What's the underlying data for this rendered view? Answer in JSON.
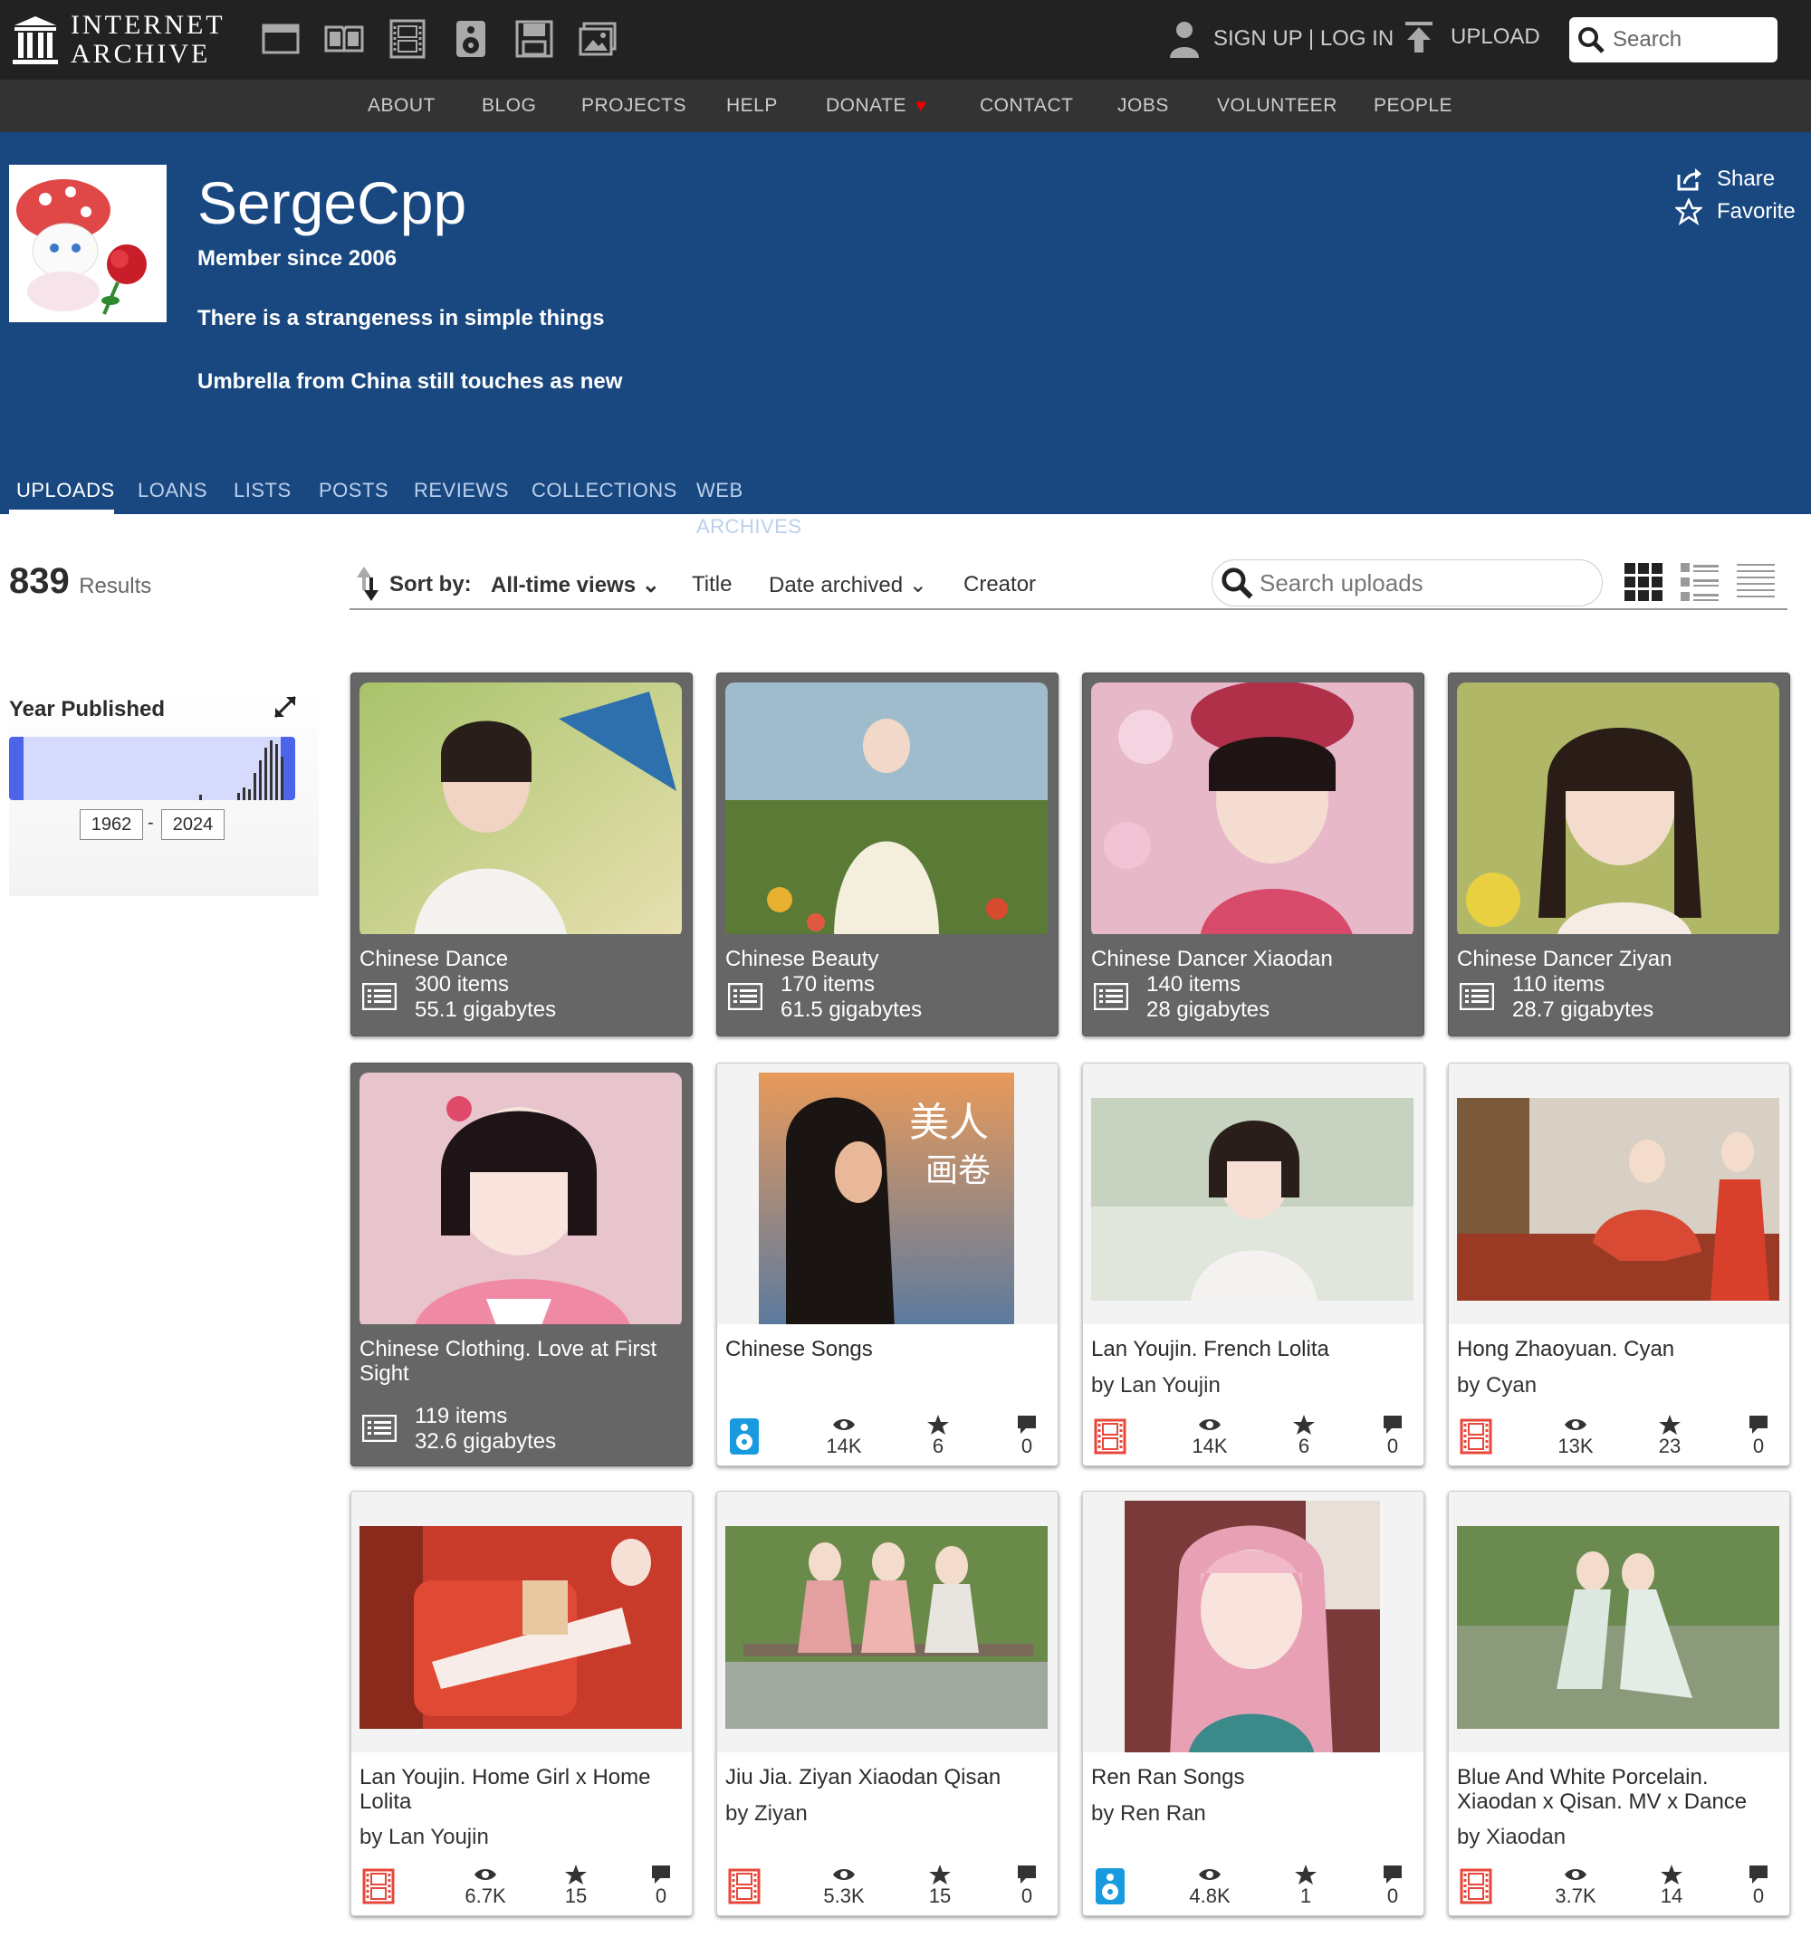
{
  "header": {
    "logo_line1": "INTERNET",
    "logo_line2": "ARCHIVE",
    "auth_label": "SIGN UP | LOG IN",
    "upload_label": "UPLOAD",
    "search_placeholder": "Search",
    "media_icons": [
      "web-icon",
      "texts-icon",
      "video-icon",
      "audio-icon",
      "software-icon",
      "images-icon"
    ]
  },
  "nav": {
    "about": "ABOUT",
    "blog": "BLOG",
    "projects": "PROJECTS",
    "help": "HELP",
    "donate": "DONATE",
    "contact": "CONTACT",
    "jobs": "JOBS",
    "volunteer": "VOLUNTEER",
    "people": "PEOPLE"
  },
  "profile": {
    "name": "SergeCpp",
    "member_since": "Member since 2006",
    "bio_line1": "There is a strangeness in simple things",
    "bio_line2": "Umbrella from China still touches as new",
    "share": "Share",
    "favorite": "Favorite"
  },
  "tabs": {
    "uploads": "UPLOADS",
    "loans": "LOANS",
    "lists": "LISTS",
    "posts": "POSTS",
    "reviews": "REVIEWS",
    "collections": "COLLECTIONS",
    "web_archives": "WEB ARCHIVES"
  },
  "results": {
    "count": "839",
    "label": "Results"
  },
  "facet": {
    "title": "Year Published",
    "from": "1962",
    "to": "2024"
  },
  "sort": {
    "label": "Sort by:",
    "views": "All-time views",
    "title": "Title",
    "date": "Date archived",
    "creator": "Creator",
    "search_placeholder": "Search uploads"
  },
  "colors": {
    "header_bg": "#222222",
    "nav_bg": "#333333",
    "profile_bg": "#194880",
    "accent": "#4b64ea"
  },
  "tiles": [
    {
      "title": "Chinese Dance",
      "items": "300 items",
      "size": "55.1 gigabytes"
    },
    {
      "title": "Chinese Beauty",
      "items": "170 items",
      "size": "61.5 gigabytes"
    },
    {
      "title": "Chinese Dancer Xiaodan",
      "items": "140 items",
      "size": "28 gigabytes"
    },
    {
      "title": "Chinese Dancer Ziyan",
      "items": "110 items",
      "size": "28.7 gigabytes"
    },
    {
      "title": "Chinese Clothing. Love at First Sight",
      "items": "119 items",
      "size": "32.6 gigabytes"
    },
    {
      "title": "Chinese Songs",
      "by": "",
      "views": "14K",
      "favs": "6",
      "reviews": "0",
      "media": "audio-icon"
    },
    {
      "title": "Lan Youjin. French Lolita",
      "by": "by Lan Youjin",
      "views": "14K",
      "favs": "6",
      "reviews": "0",
      "media": "film-icon"
    },
    {
      "title": "Hong Zhaoyuan. Cyan",
      "by": "by Cyan",
      "views": "13K",
      "favs": "23",
      "reviews": "0",
      "media": "film-icon"
    },
    {
      "title": "Lan Youjin. Home Girl x Home Lolita",
      "by": "by Lan Youjin",
      "views": "6.7K",
      "favs": "15",
      "reviews": "0",
      "media": "film-icon"
    },
    {
      "title": "Jiu Jia. Ziyan Xiaodan Qisan",
      "by": "by Ziyan",
      "views": "5.3K",
      "favs": "15",
      "reviews": "0",
      "media": "film-icon"
    },
    {
      "title": "Ren Ran Songs",
      "by": "by Ren Ran",
      "views": "4.8K",
      "favs": "1",
      "reviews": "0",
      "media": "audio-icon"
    },
    {
      "title": "Blue And White Porcelain. Xiaodan x Qisan. MV x Dance",
      "by": "by Xiaodan",
      "views": "3.7K",
      "favs": "14",
      "reviews": "0",
      "media": "film-icon"
    }
  ]
}
